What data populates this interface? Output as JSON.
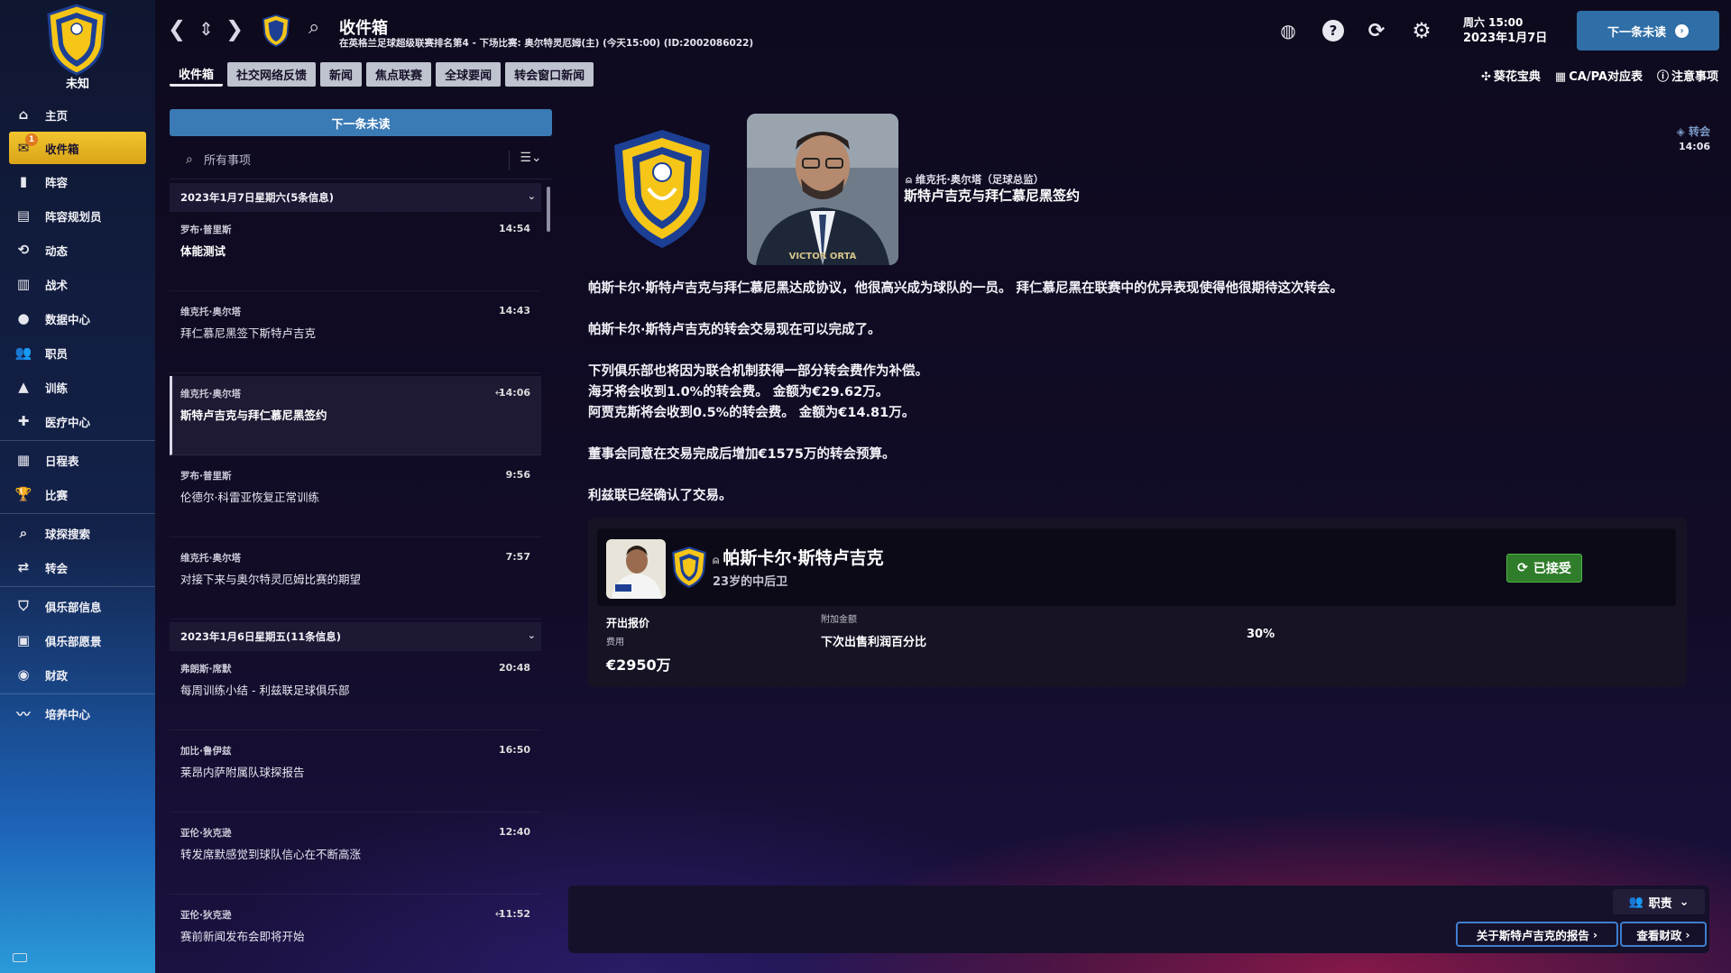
{
  "club": {
    "name": "未知"
  },
  "sidebar": {
    "items": [
      {
        "label": "主页",
        "icon": "home-icon"
      },
      {
        "label": "收件箱",
        "icon": "inbox-icon",
        "badge": "1"
      },
      {
        "label": "阵容",
        "icon": "squad-icon"
      },
      {
        "label": "阵容规划员",
        "icon": "clipboard-icon"
      },
      {
        "label": "动态",
        "icon": "dynamics-icon"
      },
      {
        "label": "战术",
        "icon": "tactics-icon"
      },
      {
        "label": "数据中心",
        "icon": "data-hub-icon"
      },
      {
        "label": "职员",
        "icon": "staff-icon"
      },
      {
        "label": "训练",
        "icon": "training-icon"
      },
      {
        "label": "医疗中心",
        "icon": "medical-icon"
      },
      {
        "label": "日程表",
        "icon": "calendar-icon"
      },
      {
        "label": "比赛",
        "icon": "trophy-icon"
      },
      {
        "label": "球探搜索",
        "icon": "scouting-icon"
      },
      {
        "label": "转会",
        "icon": "transfers-icon"
      },
      {
        "label": "俱乐部信息",
        "icon": "club-info-icon"
      },
      {
        "label": "俱乐部愿景",
        "icon": "club-vision-icon"
      },
      {
        "label": "财政",
        "icon": "finances-icon"
      },
      {
        "label": "培养中心",
        "icon": "development-icon"
      }
    ]
  },
  "header": {
    "title": "收件箱",
    "subtitle": "在英格兰足球超级联赛排名第4 - 下场比赛: 奥尔特灵厄姆(主) (今天15:00) (ID:2002086022)",
    "day_time": "周六 15:00",
    "date": "2023年1月7日",
    "next_button": "下一条未读"
  },
  "tabs": [
    "收件箱",
    "社交网络反馈",
    "新闻",
    "焦点联赛",
    "全球要闻",
    "转会窗口新闻"
  ],
  "quick_links": [
    "葵花宝典",
    "CA/PA对应表",
    "注意事项"
  ],
  "inbox": {
    "next_unread": "下一条未读",
    "search_placeholder": "所有事项",
    "group1": "2023年1月7日星期六(5条信息)",
    "group2": "2023年1月6日星期五(11条信息)",
    "messages1": [
      {
        "sender": "罗布·普里斯",
        "subject": "体能测试",
        "time": "14:54"
      },
      {
        "sender": "维克托·奥尔塔",
        "subject": "拜仁慕尼黑签下斯特卢吉克",
        "time": "14:43"
      },
      {
        "sender": "维克托·奥尔塔",
        "subject": "斯特卢吉克与拜仁慕尼黑签约",
        "time": "14:06"
      },
      {
        "sender": "罗布·普里斯",
        "subject": "伦德尔·科雷亚恢复正常训练",
        "time": "9:56"
      },
      {
        "sender": "维克托·奥尔塔",
        "subject": "对接下来与奥尔特灵厄姆比赛的期望",
        "time": "7:57"
      }
    ],
    "messages2": [
      {
        "sender": "弗朗斯·席默",
        "subject": "每周训练小结 - 利兹联足球俱乐部",
        "time": "20:48"
      },
      {
        "sender": "加比·鲁伊兹",
        "subject": "莱昂内萨附属队球探报告",
        "time": "16:50"
      },
      {
        "sender": "亚伦·狄克逊",
        "subject": "转发席默感觉到球队信心在不断高涨",
        "time": "12:40"
      },
      {
        "sender": "亚伦·狄克逊",
        "subject": "赛前新闻发布会即将开始",
        "time": "11:52"
      }
    ]
  },
  "message": {
    "sender": "维克托·奥尔塔（足球总监）",
    "headline": "斯特卢吉克与拜仁慕尼黑签约",
    "type": "转会",
    "time": "14:06",
    "photo_caption": "VICTOR ORTA",
    "paragraphs": [
      [
        "帕斯卡尔·斯特卢吉克与拜仁慕尼黑达成协议，他很高兴成为球队的一员。 拜仁慕尼黑在联赛中的优异表现使得他很期待这次转会。"
      ],
      [
        "帕斯卡尔·斯特卢吉克的转会交易现在可以完成了。"
      ],
      [
        "下列俱乐部也将因为联合机制获得一部分转会费作为补偿。",
        "海牙将会收到1.0%的转会费。 金额为€29.62万。",
        "阿贾克斯将会收到0.5%的转会费。 金额为€14.81万。"
      ],
      [
        "董事会同意在交易完成后增加€1575万的转会预算。"
      ],
      [
        "利兹联已经确认了交易。"
      ]
    ],
    "player": {
      "name": "帕斯卡尔·斯特卢吉克",
      "desc": "23岁的中后卫",
      "status": "已接受"
    },
    "offer": {
      "title": "开出报价",
      "fee_label": "费用",
      "fee": "€2950万",
      "extra_title": "附加金额",
      "extra_label": "下次出售利润百分比",
      "extra_value": "30%"
    }
  },
  "footer": {
    "role_button": "职责",
    "report_button": "关于斯特卢吉克的报告",
    "finance_button": "查看财政"
  },
  "colors": {
    "accent_blue": "#3a7ab5",
    "active_nav": "#f2c52e",
    "accepted_green": "#2f7d2a"
  }
}
